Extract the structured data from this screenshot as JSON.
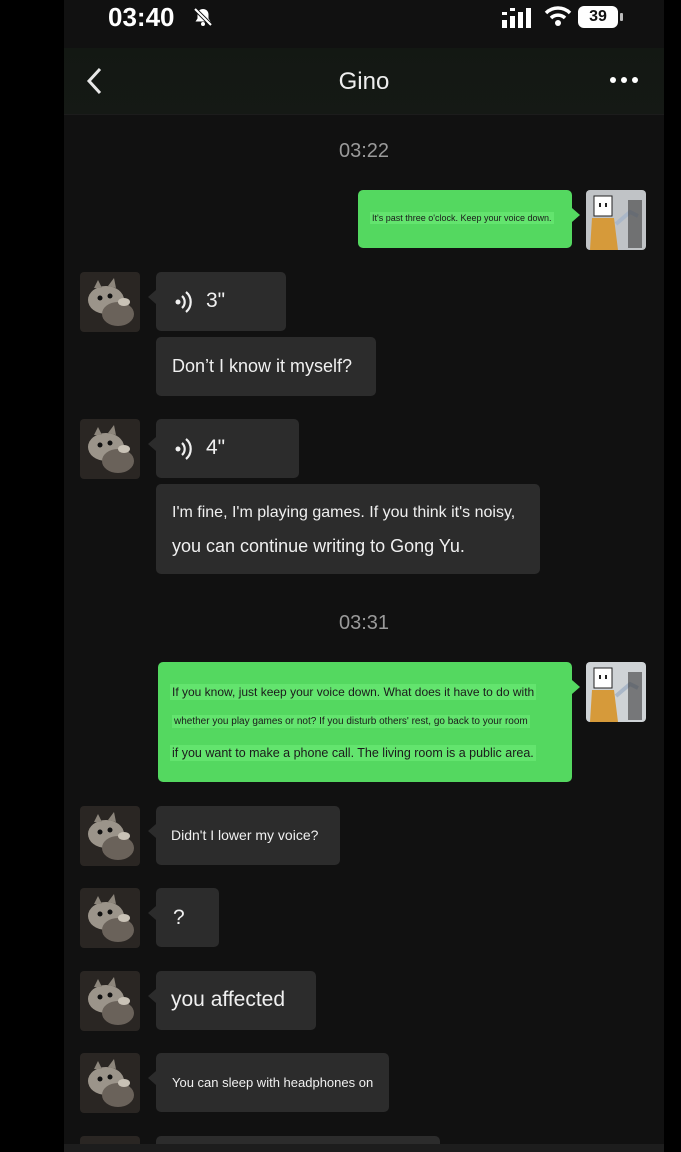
{
  "status_bar": {
    "time": "03:40",
    "battery": "39"
  },
  "header": {
    "title": "Gino"
  },
  "messages": {
    "ts1": "03:22",
    "out1": "It's past three o'clock. Keep your voice down.",
    "voice1": "3\"",
    "in1": "Don’t I know it myself?",
    "voice2": "4\"",
    "in2_line1": "I'm fine, I'm playing games. If you think it's noisy,",
    "in2_line2": "you can continue writing to Gong Yu.",
    "ts2": "03:31",
    "out2_line1": "If you know, just keep your voice down. What does it have to do with",
    "out2_line2": "whether you play games or not? If you disturb others' rest, go back to your room",
    "out2_line3": "if you want to make a phone call. The living room is a public area.",
    "in3": "Didn't I lower my voice?",
    "in4": "?",
    "in5": "you affected",
    "in6": "You can sleep with headphones on"
  },
  "colors": {
    "outgoing_bubble": "#54d860",
    "incoming_bubble": "#2c2c2c",
    "background": "#111111"
  },
  "icons": [
    "bell-slash-icon",
    "signal-icon",
    "wifi-icon",
    "battery-icon",
    "back-icon",
    "more-icon",
    "voice-icon",
    "cat-avatar",
    "self-avatar"
  ]
}
